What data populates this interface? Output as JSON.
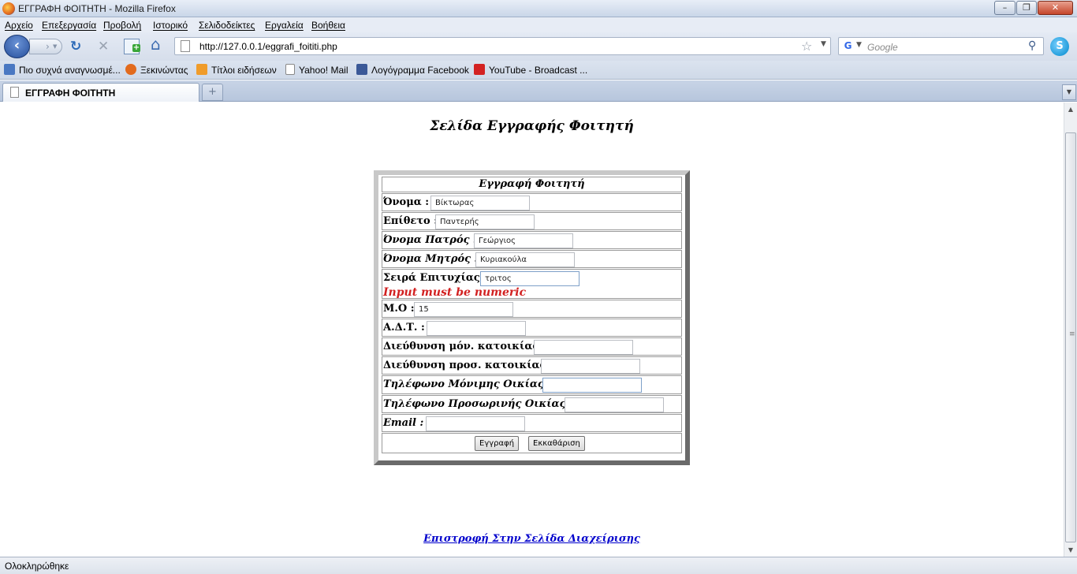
{
  "window": {
    "title": "ΕΓΓΡΑΦΗ ΦΟΙΤΗΤΗ - Mozilla Firefox",
    "min_symbol": "–",
    "max_symbol": "❐",
    "close_symbol": "✕"
  },
  "menu": [
    "Αρχείο",
    "Επεξεργασία",
    "Προβολή",
    "Ιστορικό",
    "Σελιδοδείκτες",
    "Εργαλεία",
    "Βοήθεια"
  ],
  "toolbar": {
    "back_symbol": "‹",
    "forward_symbol": "›",
    "reload_symbol": "↻",
    "stop_symbol": "✕",
    "home_symbol": "⌂",
    "url": "http://127.0.0.1/eggrafi_foititi.php",
    "star_symbol": "☆",
    "dropdown_symbol": "▼",
    "search_placeholder": "Google",
    "search_engine_letter": "G",
    "search_symbol": "⚲",
    "skype_letter": "S"
  },
  "bookmarks": [
    {
      "label": "Πιο συχνά αναγνωσμέ...",
      "icon": "most-visited-icon",
      "color": "#4a78c2"
    },
    {
      "label": "Ξεκινώντας",
      "icon": "firefox-icon",
      "color": "#e26b1e"
    },
    {
      "label": "Τίτλοι ειδήσεων",
      "icon": "rss-icon",
      "color": "#f09c2a"
    },
    {
      "label": "Yahoo! Mail",
      "icon": "page-icon",
      "color": "#ffffff"
    },
    {
      "label": "Λογόγραμμα Facebook",
      "icon": "facebook-icon",
      "color": "#3b5998"
    },
    {
      "label": "YouTube - Broadcast ...",
      "icon": "youtube-icon",
      "color": "#d32222"
    }
  ],
  "tab": {
    "label": "ΕΓΓΡΑΦΗ ΦΟΙΤΗΤΗ",
    "new_tab_symbol": "+",
    "list_symbol": "▼"
  },
  "page": {
    "title": "Σελίδα Εγγραφής Φοιτητή",
    "form": {
      "header": "Εγγραφή Φοιτητή",
      "fields": {
        "name": {
          "label": "Όνομα :",
          "value": "Βίκτωρας"
        },
        "surname": {
          "label": "Επίθετο :",
          "value": "Παντερής"
        },
        "father": {
          "label": "Όνομα Πατρός :",
          "value": "Γεώργιος"
        },
        "mother": {
          "label": "Όνομα Μητρός :",
          "value": "Κυριακούλα"
        },
        "rank": {
          "label": "Σειρά Επιτυχίας :",
          "value": "τριτος",
          "error": "Input must be numeric"
        },
        "gpa": {
          "label": "Μ.Ο :",
          "value": "15"
        },
        "id_card": {
          "label": "Α.Δ.Τ. :",
          "value": ""
        },
        "perm_address": {
          "label": "Διεύθυνση μόν. κατοικίας:",
          "value": ""
        },
        "temp_address": {
          "label": "Διεύθυνση προσ. κατοικίας:",
          "value": ""
        },
        "perm_phone": {
          "label": "Τηλέφωνο Μόνιμης Οικίας :",
          "value": ""
        },
        "temp_phone": {
          "label": "Τηλέφωνο Προσωρινής Οικίας :",
          "value": ""
        },
        "email": {
          "label": "Email :",
          "value": ""
        }
      },
      "submit_label": "Εγγραφή",
      "clear_label": "Εκκαθάριση"
    },
    "return_link": "Επιστροφή Στην Σελίδα Διαχείρισης"
  },
  "status": {
    "text": "Ολοκληρώθηκε"
  },
  "scrollbar": {
    "up_symbol": "▲",
    "down_symbol": "▼",
    "grip_symbol": "≡"
  }
}
